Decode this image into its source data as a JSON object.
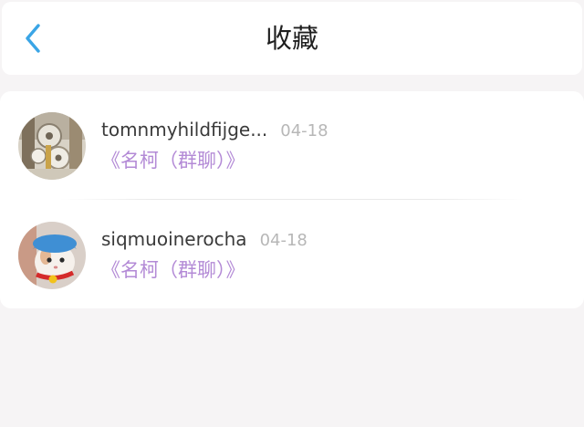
{
  "colors": {
    "accent": "#3aa5e6",
    "link": "#b38ad6",
    "date": "#b7b7b7",
    "background": "#f6f4f5"
  },
  "header": {
    "back_icon": "chevron-left-icon",
    "title": "收藏"
  },
  "favorites": [
    {
      "username": "tomnmyhildfijge...",
      "date": "04-18",
      "group": "《名柯（群聊）》",
      "avatar": "gear-figure-photo"
    },
    {
      "username": "siqmuoinerocha",
      "date": "04-18",
      "group": "《名柯（群聊）》",
      "avatar": "cat-in-blue-hat-photo"
    }
  ]
}
